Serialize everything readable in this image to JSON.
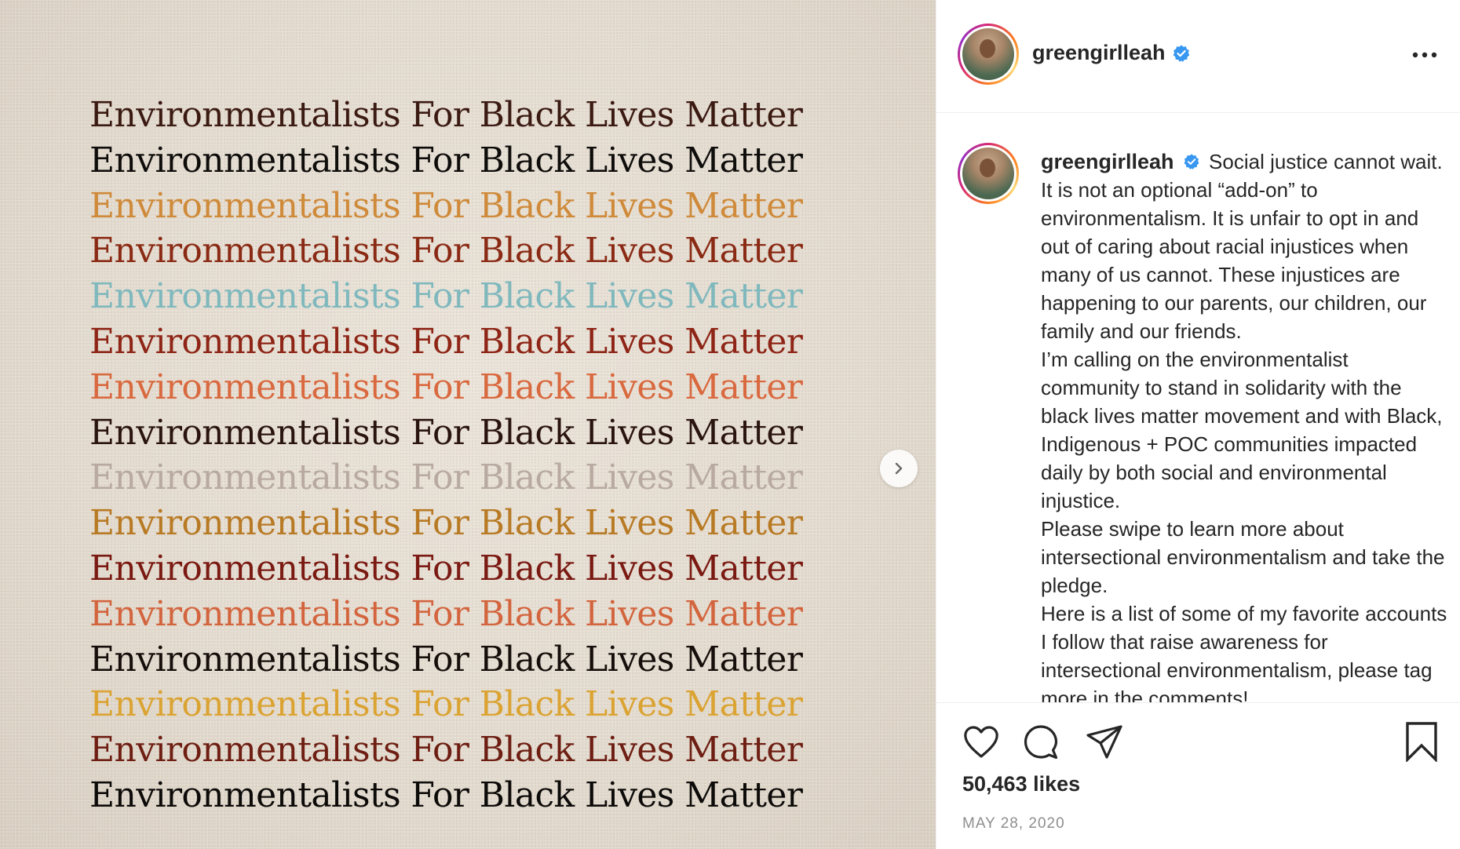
{
  "post": {
    "image": {
      "lines": [
        {
          "text": "Environmentalists For Black Lives Matter",
          "color": "#3b1a12"
        },
        {
          "text": "Environmentalists For Black Lives Matter",
          "color": "#0f0d0b"
        },
        {
          "text": "Environmentalists For Black Lives Matter",
          "color": "#cf8a3a"
        },
        {
          "text": "Environmentalists For Black Lives Matter",
          "color": "#8a2a14"
        },
        {
          "text": "Environmentalists For Black Lives Matter",
          "color": "#7fb8bd"
        },
        {
          "text": "Environmentalists For Black Lives Matter",
          "color": "#8e2516"
        },
        {
          "text": "Environmentalists For Black Lives Matter",
          "color": "#d9693f"
        },
        {
          "text": "Environmentalists For Black Lives Matter",
          "color": "#2a1410"
        },
        {
          "text": "Environmentalists For Black Lives Matter",
          "color": "#b8aaa0"
        },
        {
          "text": "Environmentalists For Black Lives Matter",
          "color": "#b87a24"
        },
        {
          "text": "Environmentalists For Black Lives Matter",
          "color": "#7a1a12"
        },
        {
          "text": "Environmentalists For Black Lives Matter",
          "color": "#d3653e"
        },
        {
          "text": "Environmentalists For Black Lives Matter",
          "color": "#160e0a"
        },
        {
          "text": "Environmentalists For Black Lives Matter",
          "color": "#dba332"
        },
        {
          "text": "Environmentalists For Black Lives Matter",
          "color": "#6e1e12"
        },
        {
          "text": "Environmentalists For Black Lives Matter",
          "color": "#0d0b09"
        }
      ],
      "next_icon": "chevron-right-icon"
    },
    "header": {
      "username": "greengirlleah",
      "verified_icon": "verified-badge-icon",
      "more_icon": "more-options-icon"
    },
    "caption": {
      "username": "greengirlleah",
      "paragraphs": [
        "Social justice cannot wait. It is not an optional “add-on” to environmentalism. It is unfair to opt in and out of caring about racial injustices when many of us cannot. These injustices are happening to our parents, our children, our family and our friends.",
        "I’m calling on the environmentalist community to stand in solidarity with the black lives matter movement and with Black, Indigenous + POC communities impacted daily by both social and environmental injustice.",
        "Please swipe to learn more about intersectional environmentalism and take the pledge.",
        "Here is a list of some of my favorite accounts I follow that raise awareness for intersectional environmentalism, please tag more in the comments!"
      ]
    },
    "actions": {
      "like_icon": "heart-icon",
      "comment_icon": "comment-icon",
      "share_icon": "share-icon",
      "save_icon": "bookmark-icon"
    },
    "likes_text": "50,463 likes",
    "date": "MAY 28, 2020",
    "colors": {
      "text": "#262626",
      "muted": "#8e8e8e",
      "verified": "#3897f0",
      "border": "#efefef"
    }
  }
}
